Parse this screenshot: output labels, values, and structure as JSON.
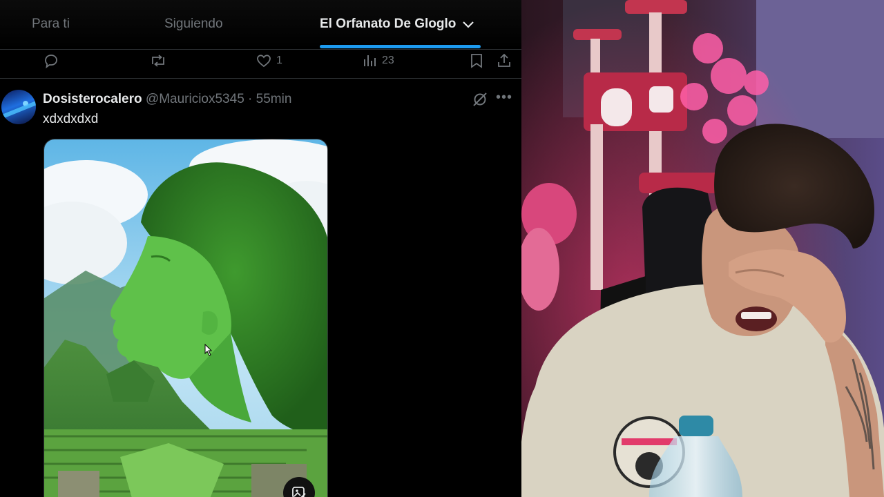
{
  "feed": {
    "tabs": [
      {
        "label": "Para ti",
        "active": false
      },
      {
        "label": "Siguiendo",
        "active": false
      },
      {
        "label": "El Orfanato De Gloglo",
        "active": true
      }
    ],
    "tab_dropdown_icon": "chevron-down-icon",
    "previous_tweet_actions": {
      "reply_icon": "reply-icon",
      "retweet_icon": "retweet-icon",
      "like_count": "1",
      "views_count": "23",
      "bookmark_icon": "bookmark-icon",
      "share_icon": "share-icon"
    },
    "tweet": {
      "display_name": "Dosisterocalero",
      "handle_time": "@Mauriciox5345 · 55min",
      "text": "xdxdxdxd",
      "grok_icon": "grok-icon",
      "more_icon": "more-icon",
      "media_badge_icon": "image-edit-icon"
    }
  },
  "colors": {
    "accent": "#1d9bf0",
    "text_primary": "#e7e9ea",
    "text_secondary": "#71767b",
    "background": "#000000"
  }
}
